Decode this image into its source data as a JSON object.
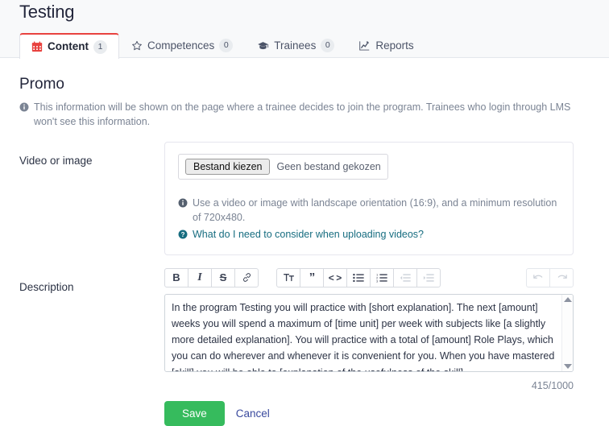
{
  "header": {
    "title": "Testing",
    "tabs": [
      {
        "label": "Content",
        "badge": "1",
        "icon": "calendar-icon",
        "active": true
      },
      {
        "label": "Competences",
        "badge": "0",
        "icon": "star-icon",
        "active": false
      },
      {
        "label": "Trainees",
        "badge": "0",
        "icon": "graduation-cap-icon",
        "active": false
      },
      {
        "label": "Reports",
        "badge": "",
        "icon": "chart-line-icon",
        "active": false
      }
    ]
  },
  "main": {
    "section_title": "Promo",
    "section_note": "This information will be shown on the page where a trainee decides to join the program. Trainees who login through LMS won't see this information.",
    "video": {
      "label": "Video or image",
      "file_button": "Bestand kiezen",
      "file_status": "Geen bestand gekozen",
      "hint": "Use a video or image with landscape orientation (16:9), and a minimum resolution of 720x480.",
      "help_link": "What do I need to consider when uploading videos?"
    },
    "description": {
      "label": "Description",
      "toolbar": [
        {
          "name": "bold-button",
          "glyph": "B",
          "disabled": false
        },
        {
          "name": "italic-button",
          "glyph": "I",
          "disabled": false
        },
        {
          "name": "strikethrough-button",
          "glyph": "S",
          "disabled": false
        },
        {
          "name": "link-button",
          "glyph": "link-icon",
          "disabled": false
        },
        {
          "name": "heading-button",
          "glyph": "TT",
          "disabled": false
        },
        {
          "name": "blockquote-button",
          "glyph": "quote-icon",
          "disabled": false
        },
        {
          "name": "code-button",
          "glyph": "<>",
          "disabled": false
        },
        {
          "name": "bullet-list-button",
          "glyph": "bullet-list-icon",
          "disabled": false
        },
        {
          "name": "numbered-list-button",
          "glyph": "numbered-list-icon",
          "disabled": false
        },
        {
          "name": "outdent-button",
          "glyph": "outdent-icon",
          "disabled": true
        },
        {
          "name": "indent-button",
          "glyph": "indent-icon",
          "disabled": true
        },
        {
          "name": "undo-button",
          "glyph": "undo-icon",
          "disabled": true
        },
        {
          "name": "redo-button",
          "glyph": "redo-icon",
          "disabled": true
        }
      ],
      "value": "In the program Testing you will practice with [short explanation]. The next [amount] weeks you will spend a maximum of [time unit] per week with subjects like [a slightly more detailed explanation]. You will practice with a total of [amount] Role Plays, which you can do wherever and whenever it is convenient for you. When you have mastered [skill] you will be able to [explanation of the usefulness of the skill].",
      "counter": "415/1000"
    }
  },
  "actions": {
    "save_label": "Save",
    "cancel_label": "Cancel"
  },
  "colors": {
    "accent_red": "#e8423f",
    "save_green": "#36bb5d",
    "link_blue": "#3a4a9e",
    "help_link_teal": "#176d80",
    "muted_text": "#7b8494"
  }
}
